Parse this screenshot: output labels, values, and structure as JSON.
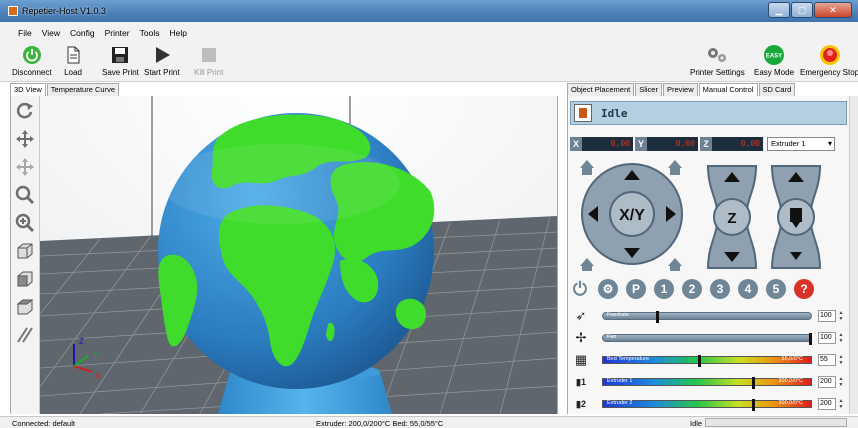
{
  "window": {
    "title": "Repetier-Host V1.0.3",
    "minimize": "▁",
    "maximize": "▢",
    "close": "✕"
  },
  "menu": [
    "File",
    "View",
    "Config",
    "Printer",
    "Tools",
    "Help"
  ],
  "toolbar": {
    "disconnect": "Disconnect",
    "load": "Load",
    "save_print": "Save Print",
    "start_print": "Start Print",
    "kill_print": "Kill Print",
    "printer_settings": "Printer Settings",
    "easy_mode": "Easy Mode",
    "easy_badge": "EASY",
    "emergency_stop": "Emergency Stop"
  },
  "left_tabs": [
    "3D View",
    "Temperature Curve"
  ],
  "right_tabs": [
    "Object Placement",
    "Slicer",
    "Preview",
    "Manual Control",
    "SD Card"
  ],
  "manual": {
    "status": "Idle",
    "x_label": "X",
    "x_value": "0,00",
    "y_label": "Y",
    "y_value": "0,00",
    "z_label": "Z",
    "z_value": "0,00",
    "extruder_select": "Extruder 1",
    "xy_label": "X/Y",
    "z_center": "Z",
    "p_label": "P",
    "tool_numbers": [
      "1",
      "2",
      "3",
      "4",
      "5"
    ],
    "help_label": "?",
    "feedrate": {
      "label": "Feedrate",
      "value": "100",
      "level": 0.25
    },
    "fan": {
      "label": "Fan",
      "value": "100",
      "level": 1.0
    },
    "bed": {
      "label": "Bed Temperature",
      "reading": "55,0/0°C",
      "value": "55",
      "level": 0.45
    },
    "extruder1": {
      "label": "Extruder 1",
      "reading": "200,0/0°C",
      "value": "200",
      "level": 0.71
    },
    "extruder2": {
      "label": "Extruder 2",
      "reading": "200,0/0°C",
      "value": "200",
      "level": 0.71
    },
    "row_icon_1": "1",
    "row_icon_2": "2"
  },
  "axes": {
    "x": "X",
    "y": "Y",
    "z": "Z"
  },
  "colors": {
    "accent": "#4a7fb8",
    "land": "#3fdc2c",
    "ocean": "#2f89c8",
    "jog": "#6f8696"
  },
  "status": {
    "connection": "Connected: default",
    "temps": "Extruder: 200,0/200°C Bed: 55,0/55°C",
    "state": "Idle"
  }
}
